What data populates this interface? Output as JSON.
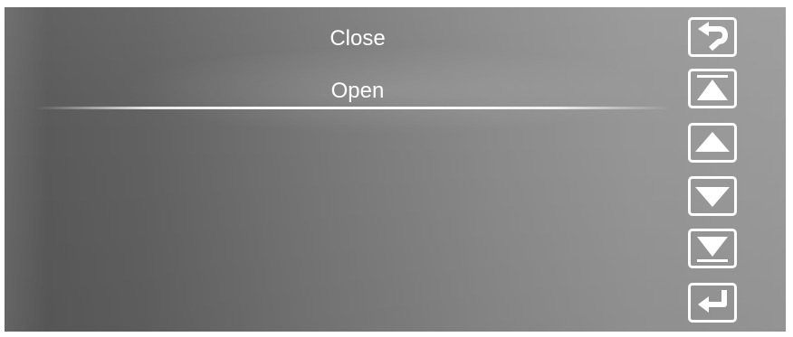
{
  "menu": {
    "options": [
      {
        "label": "Close"
      },
      {
        "label": "Open",
        "selected": true
      }
    ]
  },
  "side_buttons": [
    {
      "icon": "back-arrow-icon"
    },
    {
      "icon": "page-top-icon"
    },
    {
      "icon": "up-arrow-icon"
    },
    {
      "icon": "down-arrow-icon"
    },
    {
      "icon": "page-bottom-icon"
    },
    {
      "icon": "enter-return-icon"
    }
  ],
  "colors": {
    "background_dark": "#5a5a5a",
    "background_light": "#9b9b9b",
    "text": "#ffffff",
    "button_border": "#ffffff"
  }
}
